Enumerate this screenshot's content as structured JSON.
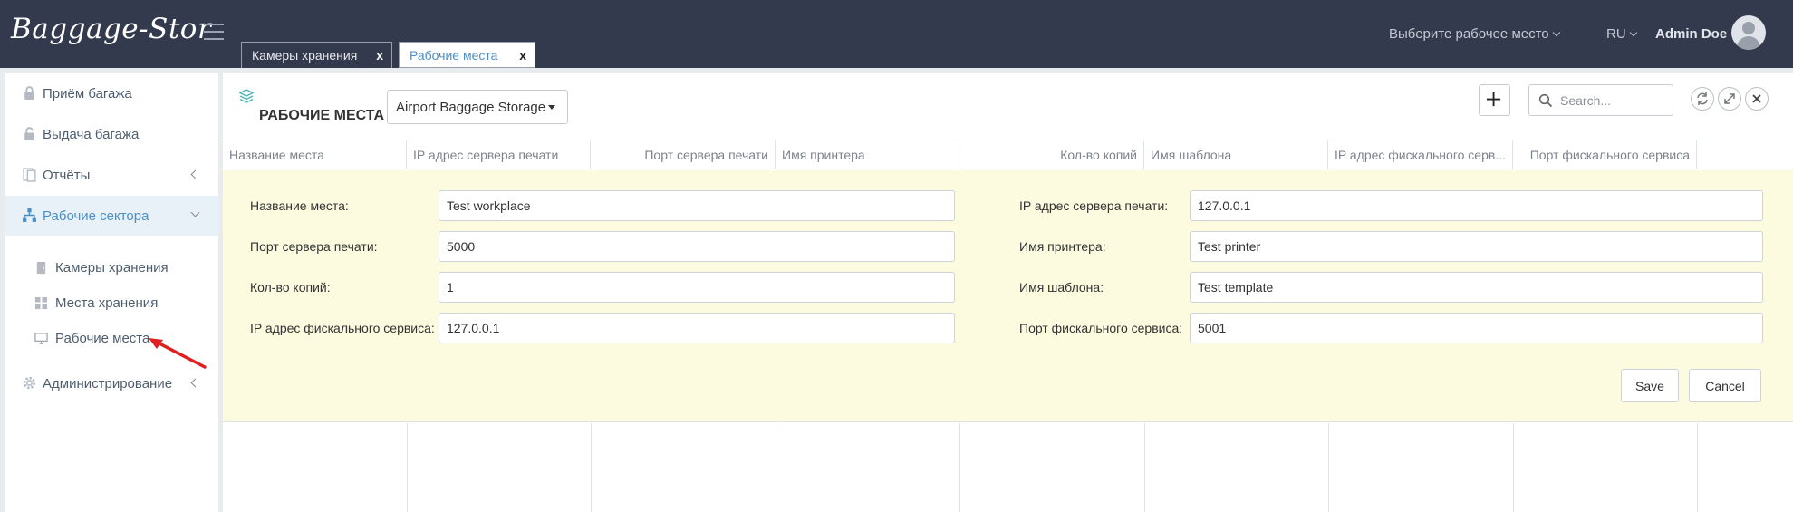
{
  "app": {
    "logo": "Baggage-Stor"
  },
  "tabs": [
    {
      "label": "Камеры хранения",
      "close": "x"
    },
    {
      "label": "Рабочие места",
      "close": "x"
    }
  ],
  "header": {
    "workplace_select": "Выберите рабочее место",
    "language": "RU",
    "user_name": "Admin Doe"
  },
  "sidebar": {
    "items": [
      {
        "label": "Приём багажа",
        "icon": "lock-icon"
      },
      {
        "label": "Выдача багажа",
        "icon": "unlock-icon"
      },
      {
        "label": "Отчёты",
        "icon": "document-icon"
      },
      {
        "label": "Рабочие сектора",
        "icon": "sitemap-icon"
      },
      {
        "label": "Администрирование",
        "icon": "gear-icon"
      }
    ],
    "sub_items": [
      {
        "label": "Камеры хранения",
        "icon": "locker-icon"
      },
      {
        "label": "Места хранения",
        "icon": "grid-icon"
      },
      {
        "label": "Рабочие места",
        "icon": "monitor-icon"
      }
    ]
  },
  "main": {
    "title": "РАБОЧИЕ МЕСТА",
    "storage_select": "Airport Baggage Storage",
    "search_placeholder": "Search..."
  },
  "table": {
    "columns": [
      "Название места",
      "IP адрес сервера печати",
      "Порт сервера печати",
      "Имя принтера",
      "Кол-во копий",
      "Имя шаблона",
      "IP адрес фискального серв...",
      "Порт фискального сервиса"
    ]
  },
  "form": {
    "fields": [
      {
        "label": "Название места:",
        "value": "Test workplace"
      },
      {
        "label": "IP адрес сервера печати:",
        "value": "127.0.0.1"
      },
      {
        "label": "Порт сервера печати:",
        "value": "5000"
      },
      {
        "label": "Имя принтера:",
        "value": "Test printer"
      },
      {
        "label": "Кол-во копий:",
        "value": "1"
      },
      {
        "label": "Имя шаблона:",
        "value": "Test template"
      },
      {
        "label": "IP адрес фискального сервиса:",
        "value": "127.0.0.1"
      },
      {
        "label": "Порт фискального сервиса:",
        "value": "5001"
      }
    ],
    "save_label": "Save",
    "cancel_label": "Cancel"
  },
  "colors": {
    "topbar": "#333a4d",
    "accent": "#4a8fc7",
    "form_background": "#fcfadf",
    "annotation_arrow": "#e02020"
  }
}
